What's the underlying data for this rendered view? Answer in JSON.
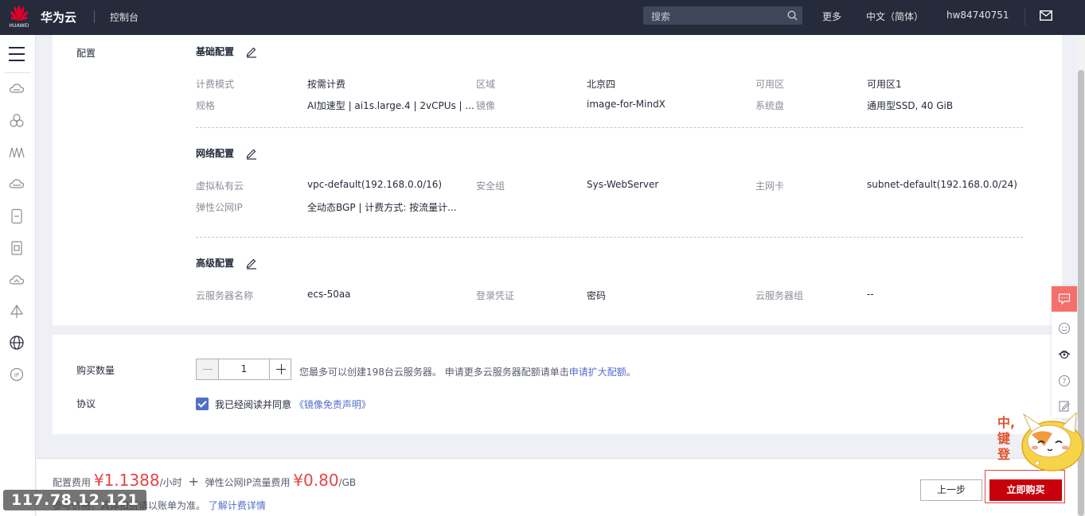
{
  "topbar": {
    "brand": "HUAWEI",
    "site_name": "华为云",
    "console": "控制台",
    "search_placeholder": "搜索",
    "more": "更多",
    "language": "中文（简体）",
    "username": "hw84740751"
  },
  "leftnav": {
    "icons": [
      "menu-icon",
      "cloud-server-icon",
      "cloud-cluster-icon",
      "network-icon",
      "storage-icon",
      "database-icon",
      "document-icon",
      "cloud-icon",
      "deploy-icon",
      "globe-icon",
      "ip-icon"
    ]
  },
  "config": {
    "label": "配置",
    "basic": {
      "title": "基础配置",
      "fields": [
        {
          "key": "计费模式",
          "value": "按需计费"
        },
        {
          "key": "区域",
          "value": "北京四"
        },
        {
          "key": "可用区",
          "value": "可用区1"
        },
        {
          "key": "规格",
          "value": "AI加速型 | ai1s.large.4 | 2vCPUs | ..."
        },
        {
          "key": "镜像",
          "value": "image-for-MindX"
        },
        {
          "key": "系统盘",
          "value": "通用型SSD, 40 GiB"
        }
      ]
    },
    "network": {
      "title": "网络配置",
      "fields": [
        {
          "key": "虚拟私有云",
          "value": "vpc-default(192.168.0.0/16)"
        },
        {
          "key": "安全组",
          "value": "Sys-WebServer"
        },
        {
          "key": "主网卡",
          "value": "subnet-default(192.168.0.0/24)"
        },
        {
          "key": "弹性公网IP",
          "value": "全动态BGP |  计费方式: 按流量计..."
        }
      ]
    },
    "advanced": {
      "title": "高级配置",
      "fields": [
        {
          "key": "云服务器名称",
          "value": "ecs-50aa"
        },
        {
          "key": "登录凭证",
          "value": "密码"
        },
        {
          "key": "云服务器组",
          "value": "--"
        }
      ]
    }
  },
  "purchase": {
    "quantity_label": "购买数量",
    "quantity_value": "1",
    "hint_prefix": "您最多可以创建198台云服务器。 申请更多云服务器配额请单击",
    "hint_link": "申请扩大配额",
    "hint_suffix": "。",
    "agreement_label": "协议",
    "agree_text": "我已经阅读并同意",
    "agree_link": "《镜像免责声明》",
    "agree_checked": true
  },
  "footer": {
    "config_fee_label": "配置费用",
    "config_fee": "¥1.1388",
    "config_fee_unit": "/小时",
    "plus": "+",
    "eip_fee_label": "弹性公网IP流量费用",
    "eip_fee": "¥0.80",
    "eip_fee_unit": "/GB",
    "note_text": "参考价格，具体扣费请以账单为准。",
    "note_link": "了解计费详情",
    "prev_button": "上一步",
    "buy_button": "立即购买"
  },
  "overlay_ip": "117.78.12.121",
  "ime_mascot_text": "中,键登",
  "colors": {
    "topbar_bg": "#252b3a",
    "accent": "#526ecc",
    "price": "#e54545",
    "buy_button": "#c7000b",
    "float_tool_active": "#f66f6a"
  }
}
